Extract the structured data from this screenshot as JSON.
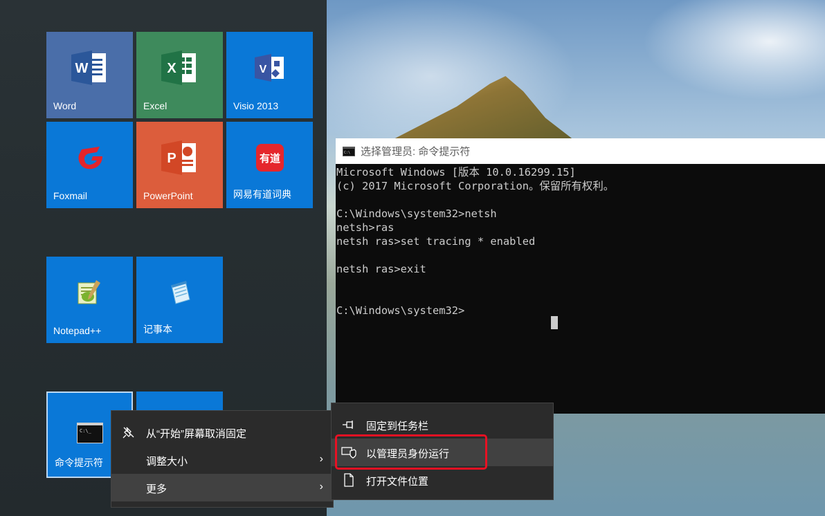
{
  "start_menu": {
    "tiles": [
      {
        "label": "Word",
        "color": "#2b579a"
      },
      {
        "label": "Excel",
        "color": "#217346"
      },
      {
        "label": "Visio 2013",
        "color": "#0078d7"
      },
      {
        "label": "Foxmail",
        "color": "#0078d7"
      },
      {
        "label": "PowerPoint",
        "color": "#d24726"
      },
      {
        "label": "网易有道词典",
        "color": "#0078d7"
      },
      {
        "label": "Notepad++",
        "color": "#0078d7"
      },
      {
        "label": "记事本",
        "color": "#0078d7"
      },
      {
        "label": "命令提示符",
        "color": "#0078d7"
      }
    ],
    "icons": {
      "word": "W",
      "excel": "X",
      "visio": "V",
      "powerpoint": "P",
      "youdao": "有道"
    }
  },
  "cmd_window": {
    "title": "选择管理员: 命令提示符",
    "output": "Microsoft Windows [版本 10.0.16299.15]\n(c) 2017 Microsoft Corporation。保留所有权利。\n\nC:\\Windows\\system32>netsh\nnetsh>ras\nnetsh ras>set tracing * enabled\n\nnetsh ras>exit\n\n\nC:\\Windows\\system32>"
  },
  "context_menu": {
    "items": [
      {
        "label": "从“开始”屏幕取消固定",
        "icon": "unpin-icon"
      },
      {
        "label": "调整大小",
        "icon": "",
        "submenu": true
      },
      {
        "label": "更多",
        "icon": "",
        "submenu": true
      }
    ],
    "chevron": "›"
  },
  "more_submenu": {
    "items": [
      {
        "label": "固定到任务栏",
        "icon": "pin-taskbar-icon"
      },
      {
        "label": "以管理员身份运行",
        "icon": "shield-run-icon"
      },
      {
        "label": "打开文件位置",
        "icon": "file-icon"
      }
    ]
  },
  "colors": {
    "accent": "#0078d7",
    "highlight_box": "#e81123",
    "menu_bg": "#2b2b2b"
  }
}
